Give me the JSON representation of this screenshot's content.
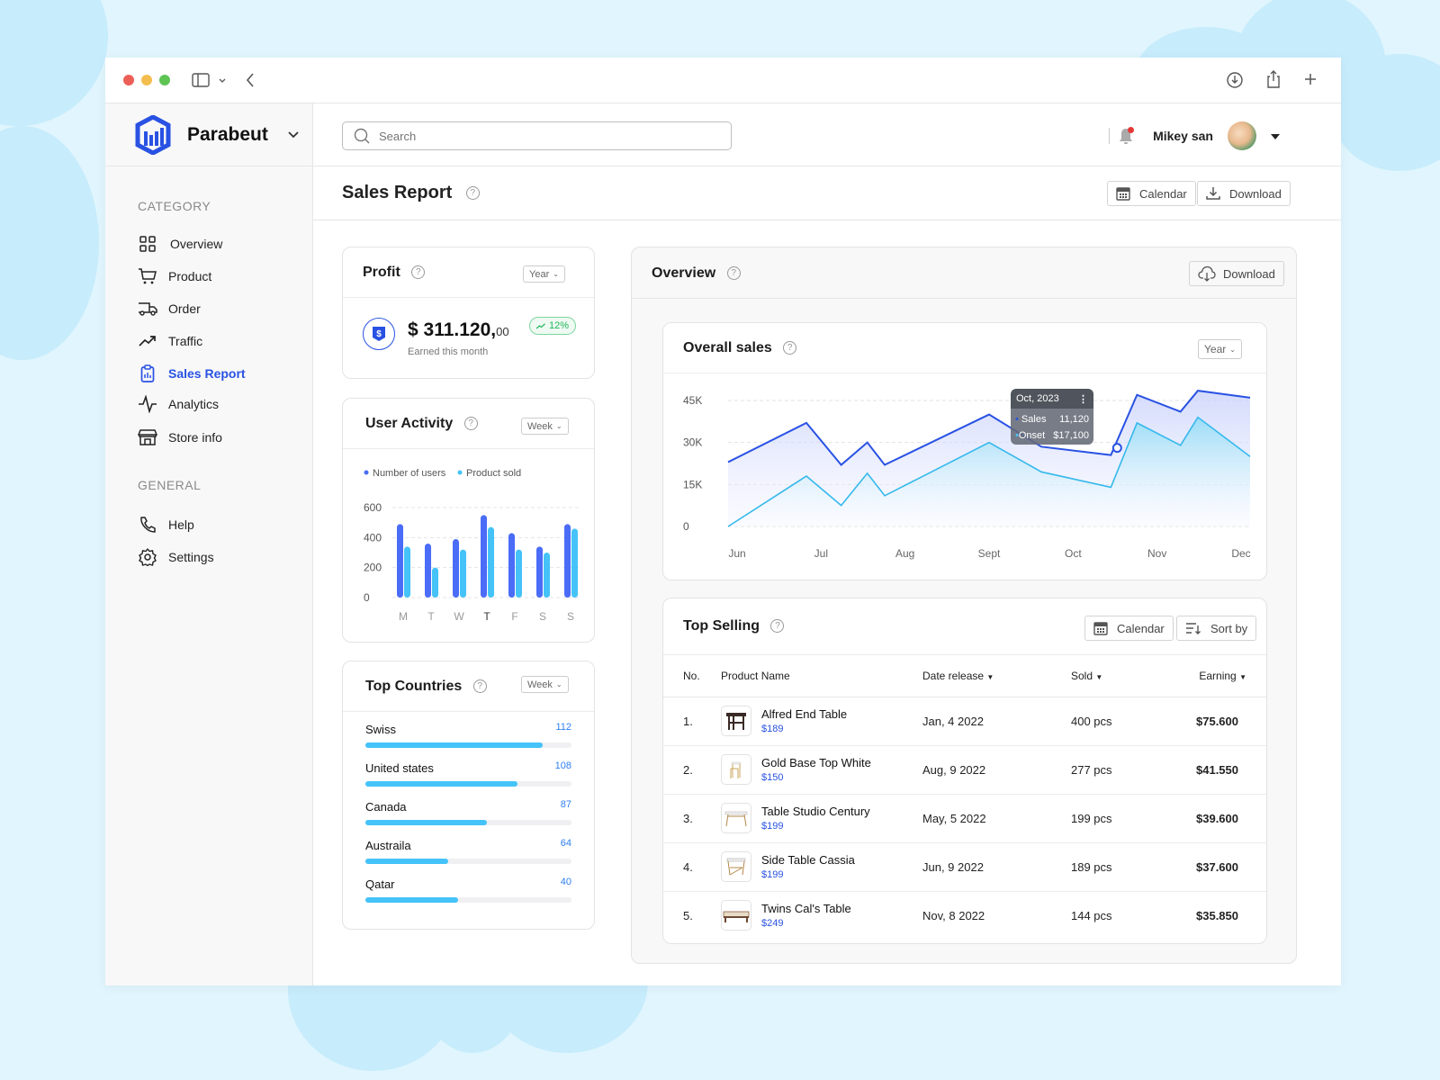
{
  "app": {
    "brand": "Parabeut"
  },
  "colors": {
    "accent": "#2952e3",
    "light": "#45c3f8",
    "success": "#22b45a",
    "notify": "#e53935"
  },
  "search": {
    "placeholder": "Search"
  },
  "user": {
    "name": "Mikey san"
  },
  "sidebar": {
    "category_title": "CATEGORY",
    "general_title": "GENERAL",
    "items": [
      {
        "label": "Overview",
        "icon": "grid-icon"
      },
      {
        "label": "Product",
        "icon": "cart-icon"
      },
      {
        "label": "Order",
        "icon": "truck-icon"
      },
      {
        "label": "Traffic",
        "icon": "trend-icon"
      },
      {
        "label": "Sales Report",
        "icon": "clipboard-chart-icon",
        "active": true
      },
      {
        "label": "Analytics",
        "icon": "pulse-icon"
      },
      {
        "label": "Store info",
        "icon": "store-icon"
      }
    ],
    "general": [
      {
        "label": "Help",
        "icon": "phone-icon"
      },
      {
        "label": "Settings",
        "icon": "gear-icon"
      }
    ]
  },
  "page": {
    "title": "Sales Report",
    "calendar_label": "Calendar",
    "download_label": "Download"
  },
  "profit": {
    "title": "Profit",
    "period": "Year",
    "amount": "$ 311.120,",
    "cents": "00",
    "caption": "Earned this month",
    "change": "12%"
  },
  "user_activity": {
    "title": "User Activity",
    "period": "Week"
  },
  "top_countries": {
    "title": "Top Countries",
    "period": "Week",
    "items": [
      {
        "name": "Swiss",
        "value": "112",
        "fill": 0.86
      },
      {
        "name": "United states",
        "value": "108",
        "fill": 0.74
      },
      {
        "name": "Canada",
        "value": "87",
        "fill": 0.59
      },
      {
        "name": "Austraila",
        "value": "64",
        "fill": 0.4
      },
      {
        "name": "Qatar",
        "value": "40",
        "fill": 0.45
      }
    ]
  },
  "overview": {
    "title": "Overview",
    "download_label": "Download"
  },
  "overall_sales": {
    "title": "Overall sales",
    "period": "Year",
    "tooltip": {
      "title": "Oct, 2023",
      "sales_label": "Sales",
      "sales_value": "11,120",
      "onset_label": "Onset",
      "onset_value": "$17,100"
    }
  },
  "top_selling": {
    "title": "Top Selling",
    "calendar_label": "Calendar",
    "sort_label": "Sort by",
    "columns": [
      "No.",
      "Product Name",
      "Date release",
      "Sold",
      "Earning"
    ],
    "rows": [
      {
        "no": "1.",
        "name": "Alfred End Table",
        "price": "$189",
        "date": "Jan, 4 2022",
        "sold": "400 pcs",
        "earning": "$75.600"
      },
      {
        "no": "2.",
        "name": "Gold Base Top White",
        "price": "$150",
        "date": "Aug, 9 2022",
        "sold": "277 pcs",
        "earning": "$41.550"
      },
      {
        "no": "3.",
        "name": "Table Studio Century",
        "price": "$199",
        "date": "May, 5 2022",
        "sold": "199 pcs",
        "earning": "$39.600"
      },
      {
        "no": "4.",
        "name": "Side Table Cassia",
        "price": "$199",
        "date": "Jun, 9 2022",
        "sold": "189 pcs",
        "earning": "$37.600"
      },
      {
        "no": "5.",
        "name": "Twins Cal's Table",
        "price": "$249",
        "date": "Nov, 8 2022",
        "sold": "144 pcs",
        "earning": "$35.850"
      }
    ]
  },
  "chart_data": [
    {
      "type": "bar",
      "title": "User Activity",
      "categories": [
        "M",
        "T",
        "W",
        "T",
        "F",
        "S",
        "S"
      ],
      "series": [
        {
          "name": "Number of users",
          "color": "#4a6cf7",
          "values": [
            490,
            360,
            390,
            550,
            430,
            340,
            490
          ]
        },
        {
          "name": "Product sold",
          "color": "#45c3f8",
          "values": [
            340,
            200,
            320,
            470,
            320,
            300,
            460
          ]
        }
      ],
      "yticks": [
        "600",
        "400",
        "200",
        "0"
      ],
      "ylim": [
        0,
        600
      ],
      "legend": "top-left"
    },
    {
      "type": "area",
      "title": "Overall sales",
      "categories": [
        "Jun",
        "Jul",
        "Aug",
        "Sept",
        "Oct",
        "Nov",
        "Dec"
      ],
      "x": [
        0,
        0.9,
        1.3,
        1.6,
        1.8,
        3.0,
        3.6,
        4.4,
        4.7,
        5.2,
        5.4,
        6.0
      ],
      "series": [
        {
          "name": "Sales",
          "color": "#2952e3",
          "values": [
            23000,
            37000,
            22000,
            30000,
            22000,
            40000,
            28500,
            25500,
            47000,
            41000,
            48500,
            46000
          ]
        },
        {
          "name": "Onset",
          "color": "#35b9ec",
          "values": [
            0,
            18000,
            7500,
            19000,
            11000,
            30000,
            19500,
            14000,
            37000,
            29000,
            39000,
            25000
          ]
        }
      ],
      "yticks": [
        "45K",
        "30K",
        "15K",
        "0"
      ],
      "ylim": [
        0,
        45000
      ],
      "highlight_index": 7
    }
  ]
}
